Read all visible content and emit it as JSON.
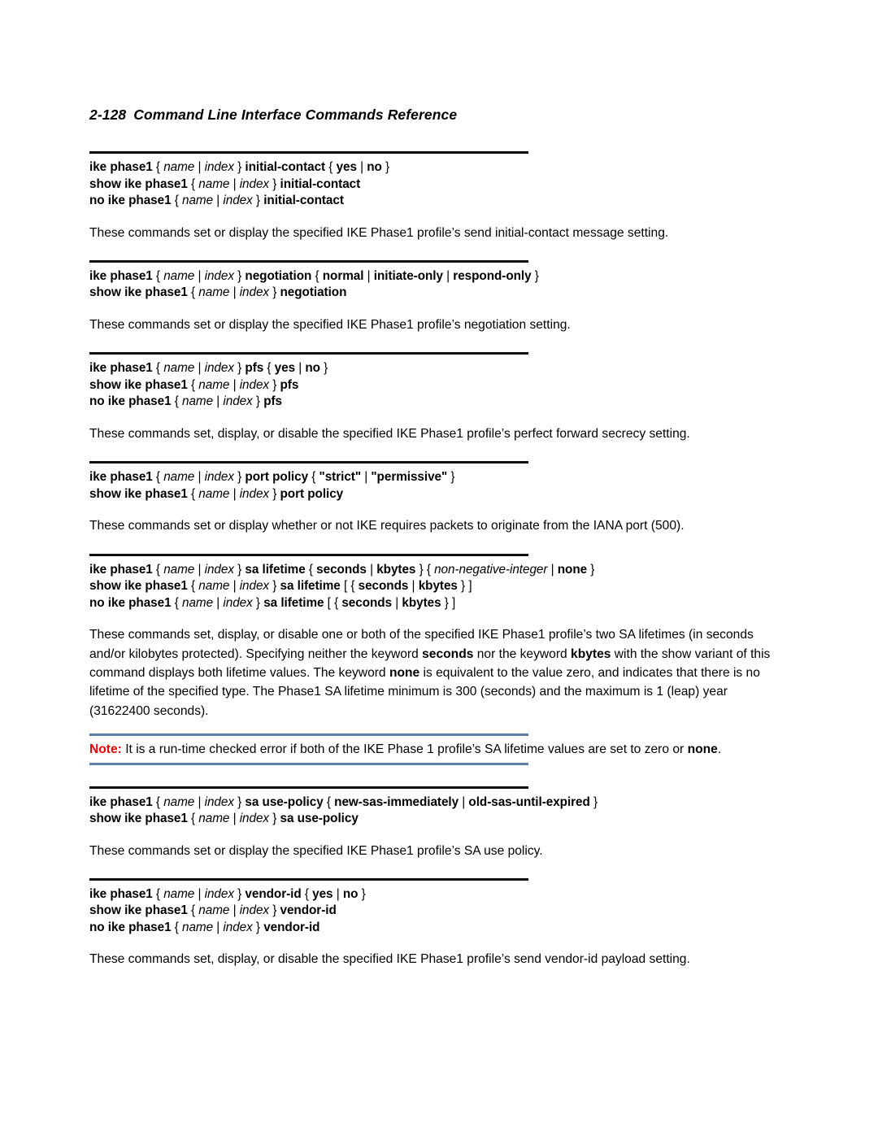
{
  "page": {
    "folio": "2-128",
    "running_head": "Command Line Interface Commands Reference"
  },
  "colors": {
    "note_label": "#ee0000",
    "note_rule": "#5c7fa3",
    "section_rule": "#0d0d0d",
    "text": "#000000",
    "background": "#ffffff"
  },
  "sections": [
    {
      "id": "initial-contact",
      "syntax_lines": [
        [
          {
            "t": "ike phase1",
            "s": "kw"
          },
          {
            "t": " { ",
            "s": "pun"
          },
          {
            "t": "name",
            "s": "var"
          },
          {
            "t": " | ",
            "s": "pun"
          },
          {
            "t": "index",
            "s": "var"
          },
          {
            "t": " } ",
            "s": "pun"
          },
          {
            "t": "initial-contact",
            "s": "kw"
          },
          {
            "t": " { ",
            "s": "pun"
          },
          {
            "t": "yes",
            "s": "kw"
          },
          {
            "t": " | ",
            "s": "pun"
          },
          {
            "t": "no",
            "s": "kw"
          },
          {
            "t": " }",
            "s": "pun"
          }
        ],
        [
          {
            "t": "show ike phase1",
            "s": "kw"
          },
          {
            "t": " { ",
            "s": "pun"
          },
          {
            "t": "name",
            "s": "var"
          },
          {
            "t": " | ",
            "s": "pun"
          },
          {
            "t": "index",
            "s": "var"
          },
          {
            "t": " } ",
            "s": "pun"
          },
          {
            "t": "initial-contact",
            "s": "kw"
          }
        ],
        [
          {
            "t": "no ike phase1",
            "s": "kw"
          },
          {
            "t": " { ",
            "s": "pun"
          },
          {
            "t": "name",
            "s": "var"
          },
          {
            "t": " | ",
            "s": "pun"
          },
          {
            "t": "index",
            "s": "var"
          },
          {
            "t": " } ",
            "s": "pun"
          },
          {
            "t": "initial-contact",
            "s": "kw"
          }
        ]
      ],
      "description": [
        {
          "t": "These commands set or display the specified IKE Phase1 profile’s send initial-contact message setting."
        }
      ]
    },
    {
      "id": "negotiation",
      "syntax_lines": [
        [
          {
            "t": "ike phase1",
            "s": "kw"
          },
          {
            "t": " { ",
            "s": "pun"
          },
          {
            "t": "name",
            "s": "var"
          },
          {
            "t": " | ",
            "s": "pun"
          },
          {
            "t": "index",
            "s": "var"
          },
          {
            "t": " } ",
            "s": "pun"
          },
          {
            "t": "negotiation",
            "s": "kw"
          },
          {
            "t": " { ",
            "s": "pun"
          },
          {
            "t": "normal",
            "s": "kw"
          },
          {
            "t": " | ",
            "s": "pun"
          },
          {
            "t": "initiate-only",
            "s": "kw"
          },
          {
            "t": " | ",
            "s": "pun"
          },
          {
            "t": "respond-only",
            "s": "kw"
          },
          {
            "t": " }",
            "s": "pun"
          }
        ],
        [
          {
            "t": "show ike phase1",
            "s": "kw"
          },
          {
            "t": " { ",
            "s": "pun"
          },
          {
            "t": "name",
            "s": "var"
          },
          {
            "t": " | ",
            "s": "pun"
          },
          {
            "t": "index",
            "s": "var"
          },
          {
            "t": " } ",
            "s": "pun"
          },
          {
            "t": "negotiation",
            "s": "kw"
          }
        ]
      ],
      "description": [
        {
          "t": "These commands set or display the specified IKE Phase1 profile’s negotiation setting."
        }
      ]
    },
    {
      "id": "pfs",
      "syntax_lines": [
        [
          {
            "t": "ike phase1",
            "s": "kw"
          },
          {
            "t": " { ",
            "s": "pun"
          },
          {
            "t": "name",
            "s": "var"
          },
          {
            "t": " | ",
            "s": "pun"
          },
          {
            "t": "index",
            "s": "var"
          },
          {
            "t": " } ",
            "s": "pun"
          },
          {
            "t": "pfs",
            "s": "kw"
          },
          {
            "t": " { ",
            "s": "pun"
          },
          {
            "t": "yes",
            "s": "kw"
          },
          {
            "t": " | ",
            "s": "pun"
          },
          {
            "t": "no",
            "s": "kw"
          },
          {
            "t": " }",
            "s": "pun"
          }
        ],
        [
          {
            "t": "show ike phase1",
            "s": "kw"
          },
          {
            "t": " { ",
            "s": "pun"
          },
          {
            "t": "name",
            "s": "var"
          },
          {
            "t": " | ",
            "s": "pun"
          },
          {
            "t": "index",
            "s": "var"
          },
          {
            "t": " } ",
            "s": "pun"
          },
          {
            "t": "pfs",
            "s": "kw"
          }
        ],
        [
          {
            "t": "no ike phase1",
            "s": "kw"
          },
          {
            "t": " { ",
            "s": "pun"
          },
          {
            "t": "name",
            "s": "var"
          },
          {
            "t": " | ",
            "s": "pun"
          },
          {
            "t": "index",
            "s": "var"
          },
          {
            "t": " } ",
            "s": "pun"
          },
          {
            "t": "pfs",
            "s": "kw"
          }
        ]
      ],
      "description": [
        {
          "t": "These commands set, display, or disable the specified IKE Phase1 profile’s perfect forward secrecy setting."
        }
      ]
    },
    {
      "id": "port-policy",
      "syntax_lines": [
        [
          {
            "t": "ike phase1",
            "s": "kw"
          },
          {
            "t": " { ",
            "s": "pun"
          },
          {
            "t": "name",
            "s": "var"
          },
          {
            "t": " | ",
            "s": "pun"
          },
          {
            "t": "index",
            "s": "var"
          },
          {
            "t": " } ",
            "s": "pun"
          },
          {
            "t": "port policy",
            "s": "kw"
          },
          {
            "t": " { ",
            "s": "pun"
          },
          {
            "t": "\"strict\"",
            "s": "kw"
          },
          {
            "t": " | ",
            "s": "pun"
          },
          {
            "t": "\"permissive\"",
            "s": "kw"
          },
          {
            "t": " }",
            "s": "pun"
          }
        ],
        [
          {
            "t": "show ike phase1",
            "s": "kw"
          },
          {
            "t": " { ",
            "s": "pun"
          },
          {
            "t": "name",
            "s": "var"
          },
          {
            "t": " | ",
            "s": "pun"
          },
          {
            "t": "index",
            "s": "var"
          },
          {
            "t": " } ",
            "s": "pun"
          },
          {
            "t": "port policy",
            "s": "kw"
          }
        ]
      ],
      "description": [
        {
          "t": "These commands set or display whether or not IKE requires packets to originate from the IANA port (500)."
        }
      ]
    },
    {
      "id": "sa-lifetime",
      "syntax_lines": [
        [
          {
            "t": "ike phase1",
            "s": "kw"
          },
          {
            "t": " { ",
            "s": "pun"
          },
          {
            "t": "name",
            "s": "var"
          },
          {
            "t": " | ",
            "s": "pun"
          },
          {
            "t": "index",
            "s": "var"
          },
          {
            "t": " } ",
            "s": "pun"
          },
          {
            "t": "sa lifetime",
            "s": "kw"
          },
          {
            "t": " { ",
            "s": "pun"
          },
          {
            "t": "seconds",
            "s": "kw"
          },
          {
            "t": " | ",
            "s": "pun"
          },
          {
            "t": "kbytes",
            "s": "kw"
          },
          {
            "t": " } { ",
            "s": "pun"
          },
          {
            "t": "non-negative-integer",
            "s": "var"
          },
          {
            "t": " | ",
            "s": "pun"
          },
          {
            "t": "none",
            "s": "kw"
          },
          {
            "t": " }",
            "s": "pun"
          }
        ],
        [
          {
            "t": "show ike phase1",
            "s": "kw"
          },
          {
            "t": " { ",
            "s": "pun"
          },
          {
            "t": "name",
            "s": "var"
          },
          {
            "t": " | ",
            "s": "pun"
          },
          {
            "t": "index",
            "s": "var"
          },
          {
            "t": " } ",
            "s": "pun"
          },
          {
            "t": "sa lifetime",
            "s": "kw"
          },
          {
            "t": " [ { ",
            "s": "pun"
          },
          {
            "t": "seconds",
            "s": "kw"
          },
          {
            "t": " | ",
            "s": "pun"
          },
          {
            "t": "kbytes",
            "s": "kw"
          },
          {
            "t": " } ]",
            "s": "pun"
          }
        ],
        [
          {
            "t": "no ike phase1",
            "s": "kw"
          },
          {
            "t": " { ",
            "s": "pun"
          },
          {
            "t": "name",
            "s": "var"
          },
          {
            "t": " | ",
            "s": "pun"
          },
          {
            "t": "index",
            "s": "var"
          },
          {
            "t": " } ",
            "s": "pun"
          },
          {
            "t": "sa lifetime",
            "s": "kw"
          },
          {
            "t": " [ { ",
            "s": "pun"
          },
          {
            "t": "seconds",
            "s": "kw"
          },
          {
            "t": " | ",
            "s": "pun"
          },
          {
            "t": "kbytes",
            "s": "kw"
          },
          {
            "t": " } ]",
            "s": "pun"
          }
        ]
      ],
      "description": [
        {
          "t": "These commands set, display, or disable one or both of the specified IKE Phase1 profile’s two SA lifetimes (in seconds and/or kilobytes protected). Specifying neither the keyword "
        },
        {
          "t": "seconds",
          "s": "b"
        },
        {
          "t": " nor the keyword "
        },
        {
          "t": "kbytes",
          "s": "b"
        },
        {
          "t": " with the show variant of this command displays both lifetime values. The keyword "
        },
        {
          "t": "none",
          "s": "b"
        },
        {
          "t": " is equivalent to the value zero, and indicates that there is no lifetime of the specified type. The Phase1 SA lifetime minimum is 300 (seconds) and the maximum is 1 (leap) year (31622400 seconds)."
        }
      ]
    },
    {
      "id": "sa-use-policy",
      "syntax_lines": [
        [
          {
            "t": "ike phase1",
            "s": "kw"
          },
          {
            "t": " { ",
            "s": "pun"
          },
          {
            "t": "name",
            "s": "var"
          },
          {
            "t": " | ",
            "s": "pun"
          },
          {
            "t": "index",
            "s": "var"
          },
          {
            "t": " } ",
            "s": "pun"
          },
          {
            "t": "sa use-policy",
            "s": "kw"
          },
          {
            "t": " { ",
            "s": "pun"
          },
          {
            "t": "new-sas-immediately",
            "s": "kw"
          },
          {
            "t": " | ",
            "s": "pun"
          },
          {
            "t": "old-sas-until-expired",
            "s": "kw"
          },
          {
            "t": " }",
            "s": "pun"
          }
        ],
        [
          {
            "t": "show ike phase1",
            "s": "kw"
          },
          {
            "t": " { ",
            "s": "pun"
          },
          {
            "t": "name",
            "s": "var"
          },
          {
            "t": " | ",
            "s": "pun"
          },
          {
            "t": "index",
            "s": "var"
          },
          {
            "t": " } ",
            "s": "pun"
          },
          {
            "t": "sa use-policy",
            "s": "kw"
          }
        ]
      ],
      "description": [
        {
          "t": "These commands set or display the specified IKE Phase1 profile’s SA use policy."
        }
      ]
    },
    {
      "id": "vendor-id",
      "syntax_lines": [
        [
          {
            "t": "ike phase1",
            "s": "kw"
          },
          {
            "t": " { ",
            "s": "pun"
          },
          {
            "t": "name",
            "s": "var"
          },
          {
            "t": " | ",
            "s": "pun"
          },
          {
            "t": "index",
            "s": "var"
          },
          {
            "t": " } ",
            "s": "pun"
          },
          {
            "t": "vendor-id",
            "s": "kw"
          },
          {
            "t": " { ",
            "s": "pun"
          },
          {
            "t": "yes",
            "s": "kw"
          },
          {
            "t": " | ",
            "s": "pun"
          },
          {
            "t": "no",
            "s": "kw"
          },
          {
            "t": " }",
            "s": "pun"
          }
        ],
        [
          {
            "t": "show ike phase1",
            "s": "kw"
          },
          {
            "t": " { ",
            "s": "pun"
          },
          {
            "t": "name",
            "s": "var"
          },
          {
            "t": " | ",
            "s": "pun"
          },
          {
            "t": "index",
            "s": "var"
          },
          {
            "t": " } ",
            "s": "pun"
          },
          {
            "t": "vendor-id",
            "s": "kw"
          }
        ],
        [
          {
            "t": "no ike phase1",
            "s": "kw"
          },
          {
            "t": " { ",
            "s": "pun"
          },
          {
            "t": "name",
            "s": "var"
          },
          {
            "t": " | ",
            "s": "pun"
          },
          {
            "t": "index",
            "s": "var"
          },
          {
            "t": " } ",
            "s": "pun"
          },
          {
            "t": "vendor-id",
            "s": "kw"
          }
        ]
      ],
      "description": [
        {
          "t": "These commands set, display, or disable the specified IKE Phase1 profile’s send vendor-id payload setting."
        }
      ]
    }
  ],
  "note": {
    "label": "Note:",
    "body": [
      {
        "t": " It is a run-time checked error if both of the IKE Phase 1 profile’s SA lifetime values are set to zero or "
      },
      {
        "t": "none",
        "s": "b"
      },
      {
        "t": "."
      }
    ]
  }
}
